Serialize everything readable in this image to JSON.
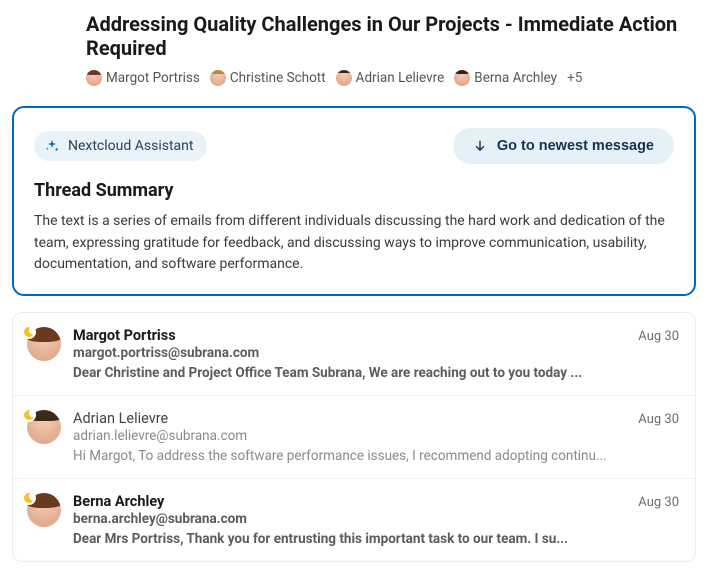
{
  "title": "Addressing Quality Challenges in Our Projects - Immediate Action Required",
  "participants": [
    {
      "name": "Margot Portriss",
      "bg": "#e6b398"
    },
    {
      "name": "Christine Schott",
      "bg": "#c8a874"
    },
    {
      "name": "Adrian Lelievre",
      "bg": "#d9b38f"
    },
    {
      "name": "Berna Archley",
      "bg": "#e0b8a0"
    }
  ],
  "more_count": "+5",
  "assistant_label": "Nextcloud Assistant",
  "newest_label": "Go to newest message",
  "summary_title": "Thread Summary",
  "summary_text": "The text is a series of emails from different individuals discussing the hard work and dedication of the team, expressing gratitude for feedback, and discussing ways to improve communication, usability, documentation, and software performance.",
  "messages": [
    {
      "name": "Margot Portriss",
      "email": "margot.portriss@subrana.com",
      "date": "Aug 30",
      "preview": "Dear Christine and Project Office Team Subrana, We are reaching out to you today ...",
      "unread": true,
      "hair": "hair-brown"
    },
    {
      "name": "Adrian Lelievre",
      "email": "adrian.lelievre@subrana.com",
      "date": "Aug 30",
      "preview": "Hi Margot,   To address the software performance issues, I recommend adopting continu...",
      "unread": false,
      "hair": "hair-short"
    },
    {
      "name": "Berna Archley",
      "email": "berna.archley@subrana.com",
      "date": "Aug 30",
      "preview": "Dear Mrs Portriss,   Thank you for entrusting this important task to our team.   I su...",
      "unread": true,
      "hair": "hair-brown"
    }
  ]
}
